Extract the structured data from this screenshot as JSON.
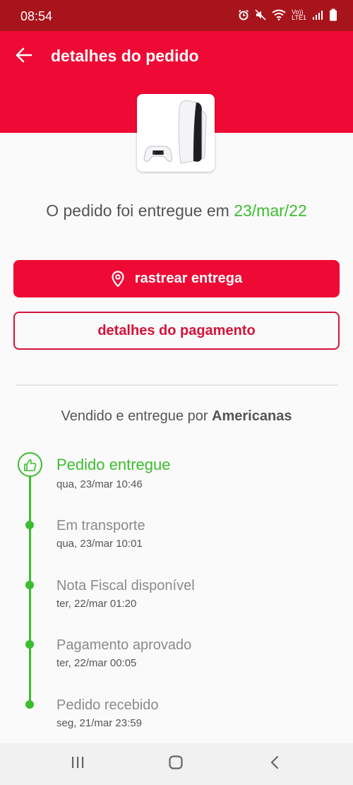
{
  "status": {
    "time": "08:54",
    "lte_label": "LTE1",
    "volte_label": "Vo))"
  },
  "header": {
    "title": "detalhes do pedido"
  },
  "order": {
    "delivery_prefix": "O pedido foi entregue em",
    "delivery_date": "23/mar/22",
    "track_button_label": "rastrear entrega",
    "payment_button_label": "detalhes do pagamento",
    "seller_prefix": "Vendido e entregue por",
    "seller_name": "Americanas"
  },
  "timeline": [
    {
      "title": "Pedido entregue",
      "date": "qua, 23/mar 10:46"
    },
    {
      "title": "Em transporte",
      "date": "qua, 23/mar 10:01"
    },
    {
      "title": "Nota Fiscal disponível",
      "date": "ter, 22/mar 01:20"
    },
    {
      "title": "Pagamento aprovado",
      "date": "ter, 22/mar 00:05"
    },
    {
      "title": "Pedido recebido",
      "date": "seg, 21/mar 23:59"
    }
  ],
  "colors": {
    "brand_red": "#ee0a35",
    "status_bar": "#a8141b",
    "success_green": "#3cbd2f"
  },
  "icons": [
    "alarm-icon",
    "mute-icon",
    "wifi-icon",
    "signal-icon",
    "battery-icon",
    "back-arrow-icon",
    "location-pin-icon",
    "thumbs-up-icon",
    "recents-icon",
    "home-icon",
    "nav-back-icon"
  ]
}
